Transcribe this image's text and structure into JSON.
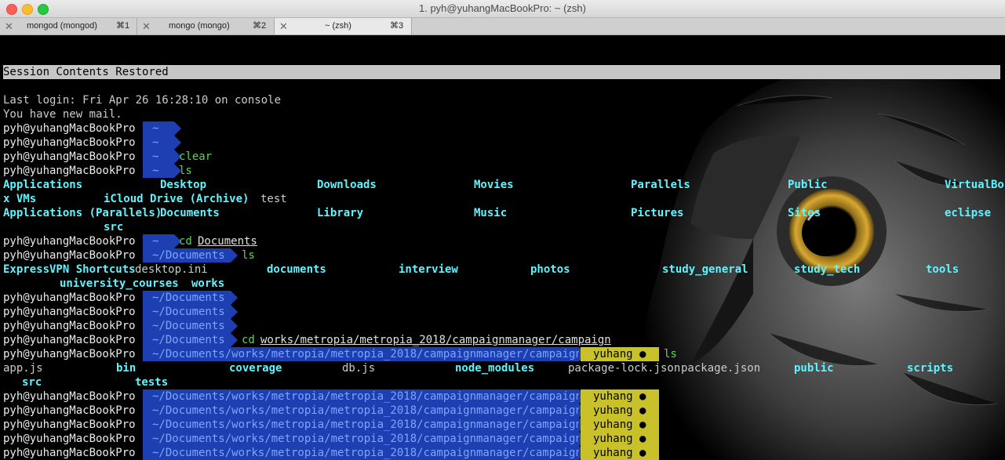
{
  "window": {
    "title": "1. pyh@yuhangMacBookPro: ~ (zsh)"
  },
  "tabs": [
    {
      "label": "mongod (mongod)",
      "shortcut": "⌘1",
      "active": false
    },
    {
      "label": "mongo (mongo)",
      "shortcut": "⌘2",
      "active": false
    },
    {
      "label": "~ (zsh)",
      "shortcut": "⌘3",
      "active": true
    }
  ],
  "terminal": {
    "banner": "Session Contents Restored",
    "last_login": "Last login: Fri Apr 26 16:28:10 on console",
    "mail": "You have new mail.",
    "user": "pyh@yuhangMacBookPro",
    "home_dir": "~",
    "docs_dir": "~/Documents",
    "campaign_dir": "~/Documents/works/metropia/metropia_2018/campaignmanager/campaign",
    "git_branch": "yuhang ●",
    "cmd_clear": "clear",
    "cmd_ls": "ls",
    "cmd_cd": "cd",
    "arg_documents": "Documents",
    "arg_campaign": "works/metropia/metropia_2018/campaignmanager/campaign",
    "home_ls": {
      "r1": [
        "Applications",
        "Desktop",
        "Downloads",
        "Movies",
        "Parallels",
        "Public",
        "VirtualBo"
      ],
      "r2": [
        "x VMs",
        "iCloud Drive (Archive)",
        "test"
      ],
      "r3": [
        "Applications (Parallels)",
        "Documents",
        "Library",
        "Music",
        "Pictures",
        "Sites",
        "eclipse"
      ],
      "r4": [
        "src"
      ]
    },
    "docs_ls": {
      "r1": [
        "ExpressVPN Shortcuts",
        "desktop.ini",
        "documents",
        "interview",
        "photos",
        "study_general",
        "study_tech",
        "tools"
      ],
      "r2": [
        "university_courses",
        "works"
      ]
    },
    "campaign_ls": {
      "r1": [
        "app.js",
        "bin",
        "coverage",
        "db.js",
        "node_modules",
        "package-lock.json",
        "package.json",
        "public",
        "scripts"
      ],
      "r2": [
        "src",
        "tests"
      ]
    }
  }
}
